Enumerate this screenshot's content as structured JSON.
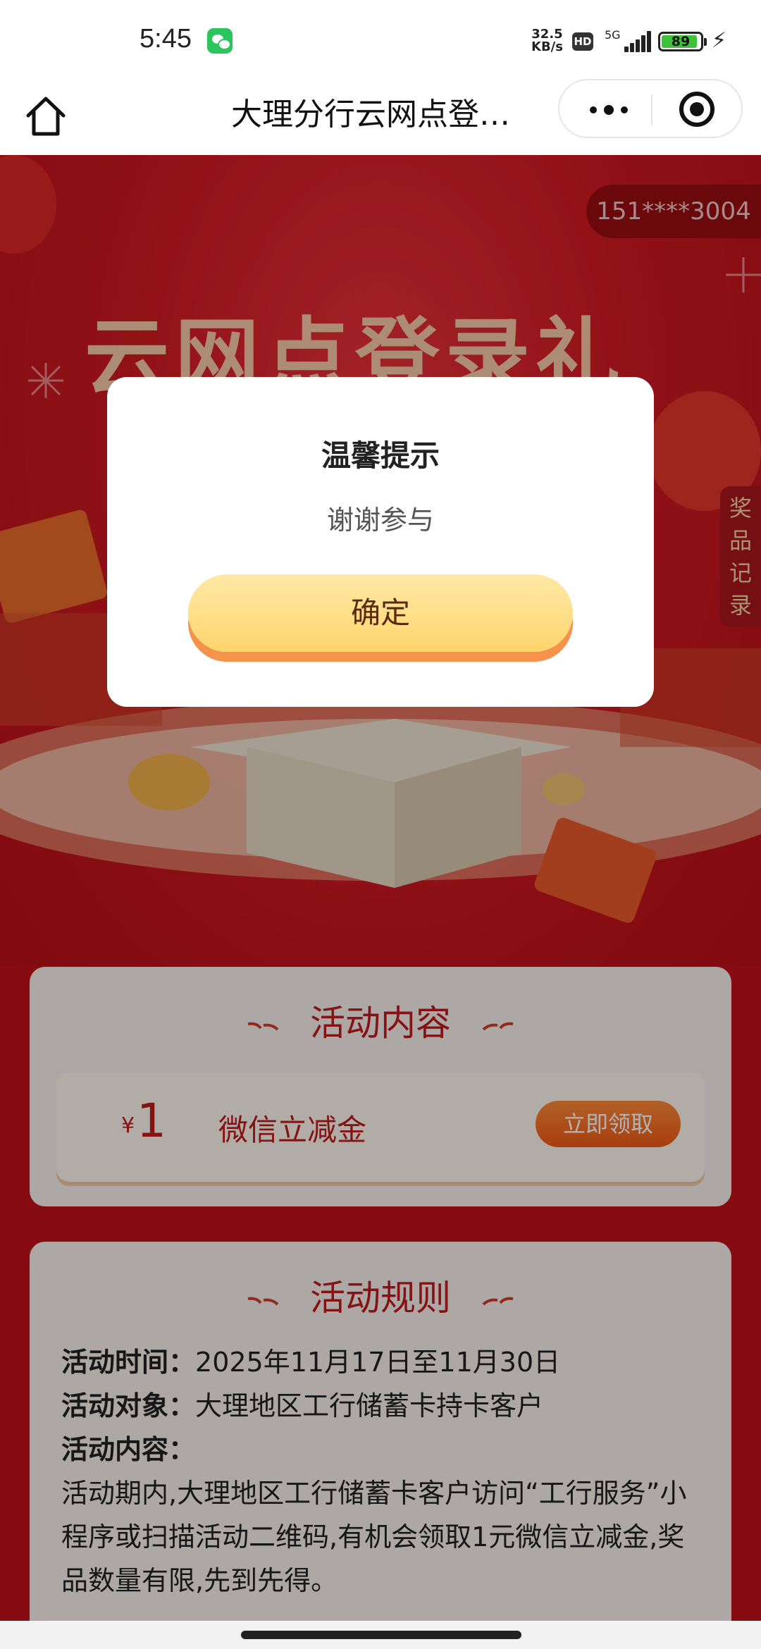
{
  "status_bar": {
    "time": "5:45",
    "net_speed_value": "32.5",
    "net_speed_unit": "KB/s",
    "hd_badge": "HD",
    "network": "5G",
    "battery": "89"
  },
  "nav": {
    "title": "大理分行云网点登…"
  },
  "hero": {
    "phone_mask": "151****3004",
    "title": "云网点登录礼",
    "record_tab": "奖品记录"
  },
  "activity_content": {
    "title": "活动内容",
    "currency": "¥",
    "amount": "1",
    "prize_name": "微信立减金",
    "claim_button": "立即领取"
  },
  "rules": {
    "title": "活动规则",
    "time_label": "活动时间：",
    "time_value": "2025年11月17日至11月30日",
    "target_label": "活动对象：",
    "target_value": "大理地区工行储蓄卡持卡客户",
    "content_label": "活动内容：",
    "content_text": "活动期内,大理地区工行储蓄卡客户访问“工行服务”小程序或扫描活动二维码,有机会领取1元微信立减金,奖品数量有限,先到先得。"
  },
  "modal": {
    "title": "温馨提示",
    "message": "谢谢参与",
    "confirm_button": "确定"
  },
  "colors": {
    "brand_red": "#c0121b",
    "accent_orange": "#f05a16",
    "button_gold": "#ffd56b"
  }
}
